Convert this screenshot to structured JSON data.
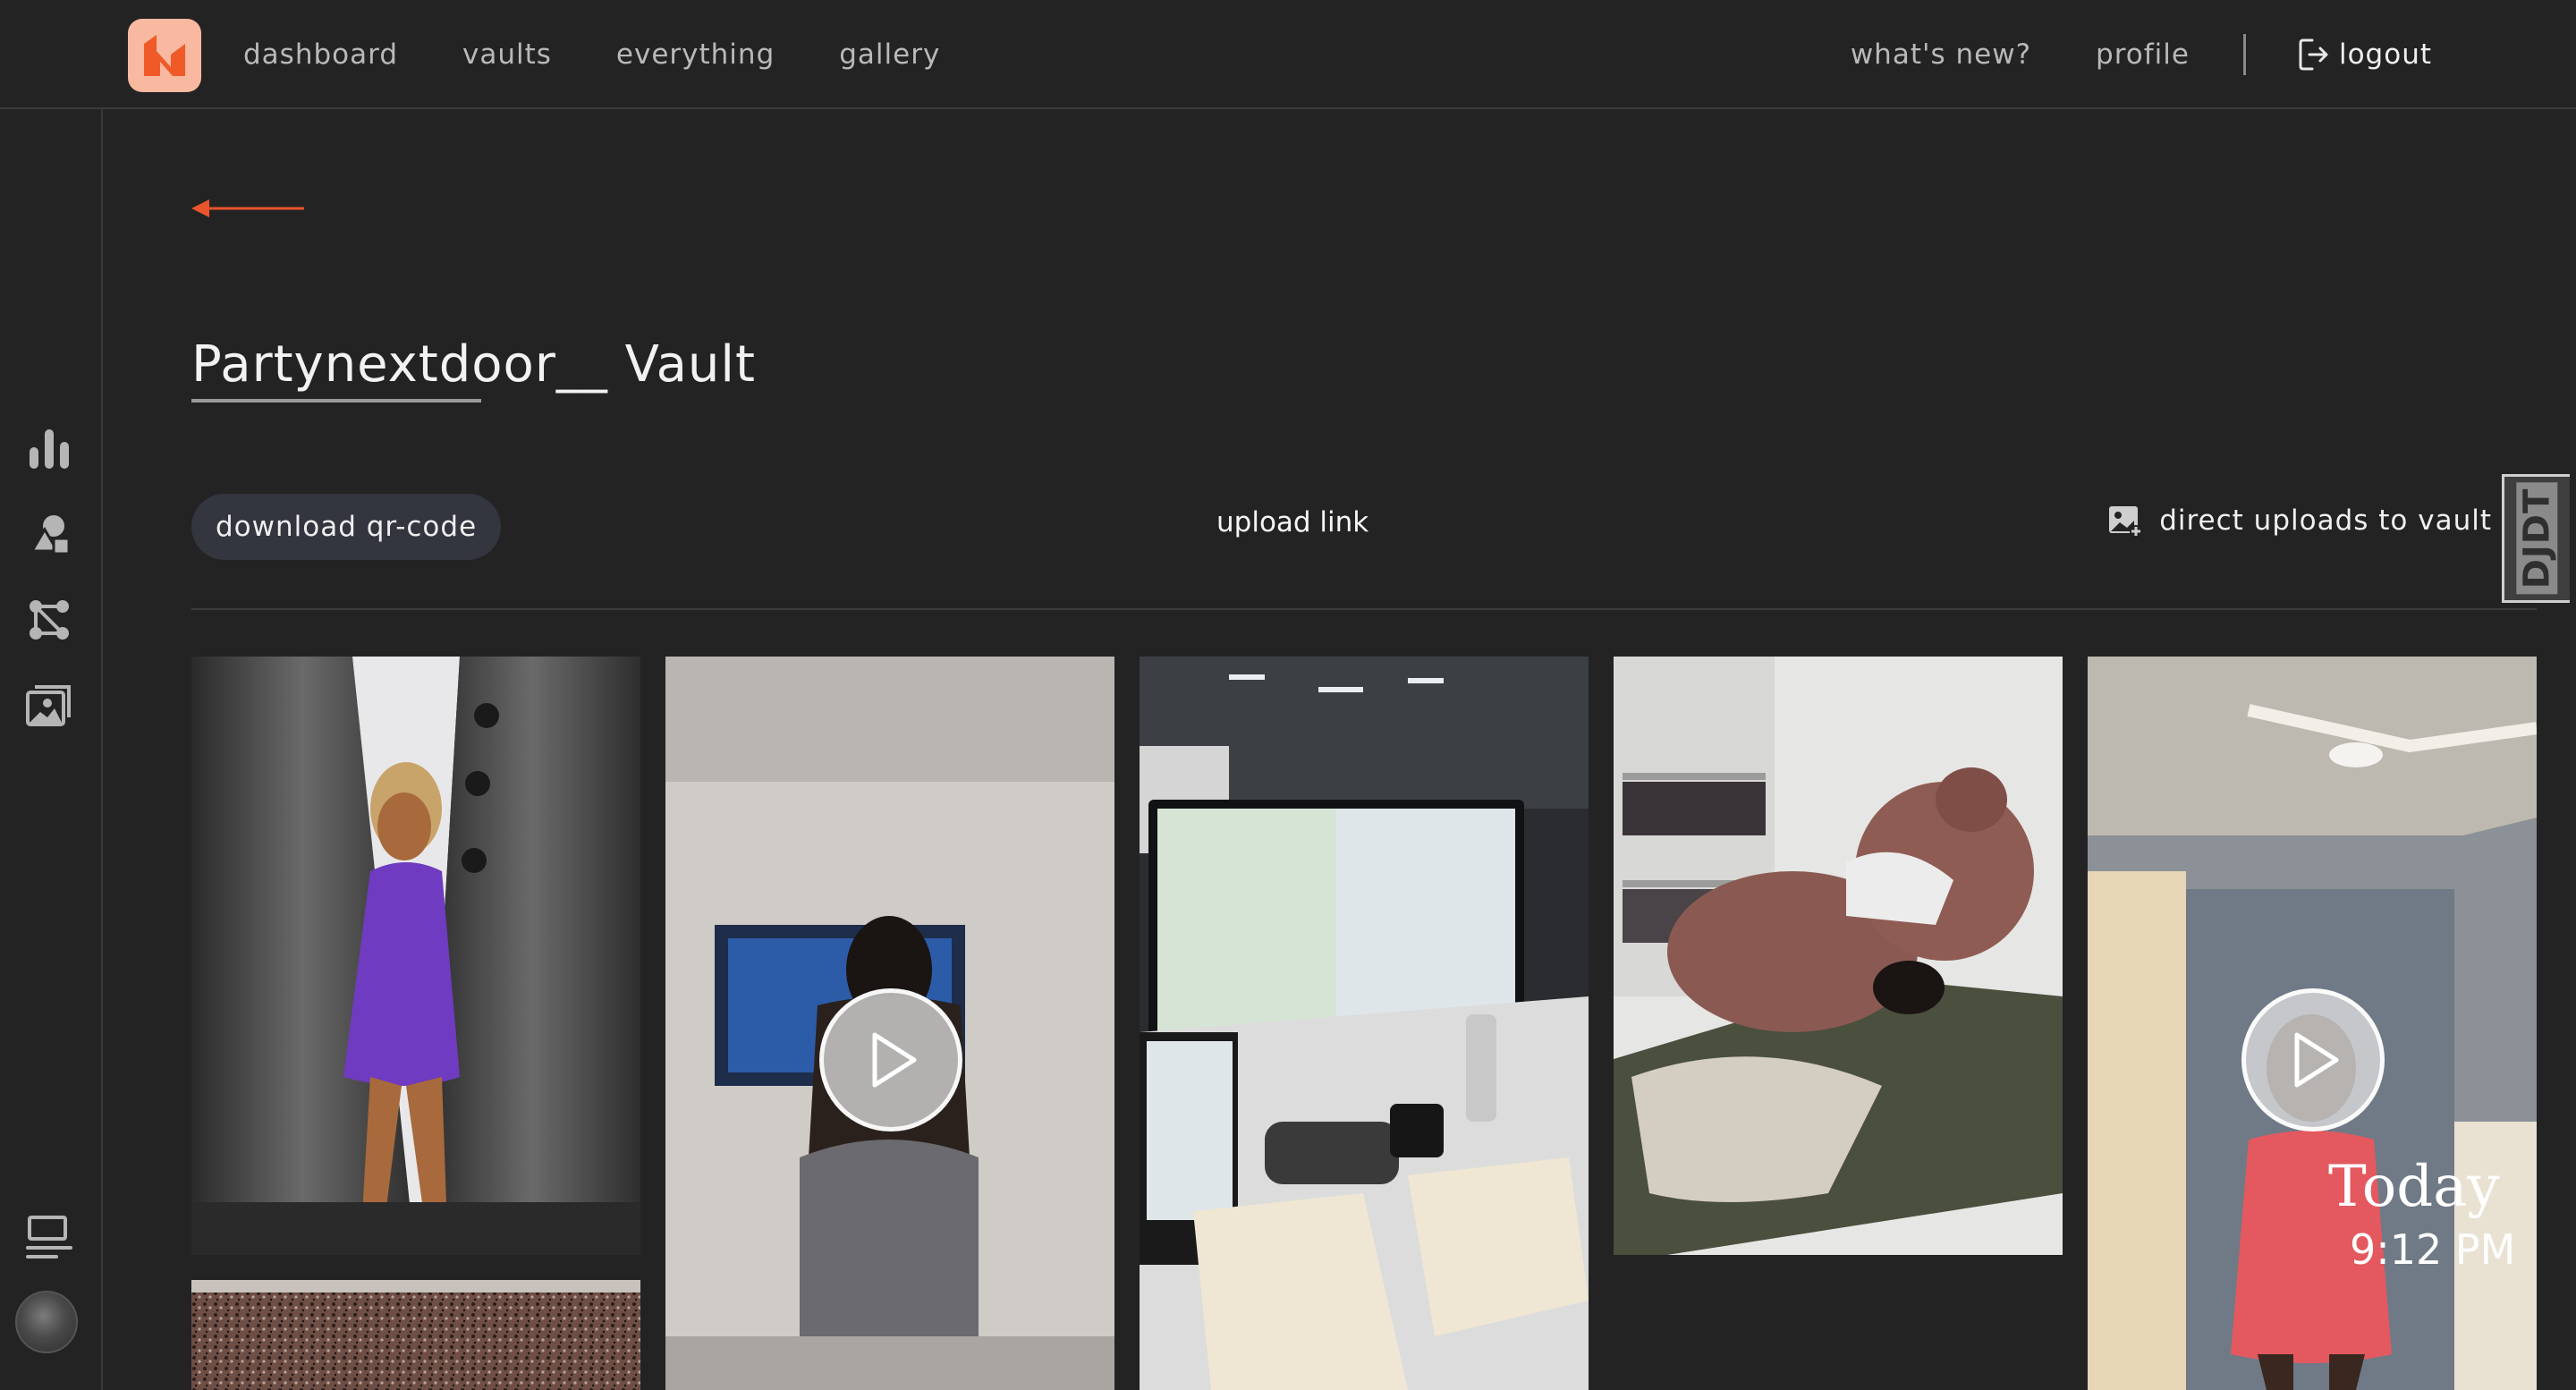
{
  "nav": {
    "links": [
      "dashboard",
      "vaults",
      "everything",
      "gallery"
    ],
    "whats_new": "what's new?",
    "profile": "profile",
    "logout": "logout"
  },
  "logo": {
    "icon": "brand-logo",
    "color": "#f05a28",
    "background": "#f9b8a0"
  },
  "sidebar": {
    "icons": [
      "bar-chart-icon",
      "shapes-icon",
      "nodes-icon",
      "image-gallery-icon",
      "list-icon"
    ]
  },
  "vault": {
    "title": "Partynextdoor__ Vault"
  },
  "actions": {
    "download_qr": "download qr-code",
    "upload_link": "upload link",
    "direct_uploads": "direct uploads to vault"
  },
  "debug_toolbar": {
    "label": "DJDT"
  },
  "gallery": {
    "items": [
      {
        "kind": "photo",
        "description": "woman-in-purple-dress"
      },
      {
        "kind": "video",
        "description": "woman-facing-tv"
      },
      {
        "kind": "photo",
        "description": "office-desk-monitors"
      },
      {
        "kind": "photo",
        "description": "giant-teddy-bear-on-bed"
      },
      {
        "kind": "video",
        "description": "woman-in-red-dress"
      },
      {
        "kind": "photo",
        "description": "granite-surface"
      }
    ],
    "video_overlay": {
      "day": "Today",
      "time": "9:12 PM"
    }
  },
  "colors": {
    "background": "#232323",
    "accent": "#e8542c",
    "button_bg": "#33353f"
  }
}
